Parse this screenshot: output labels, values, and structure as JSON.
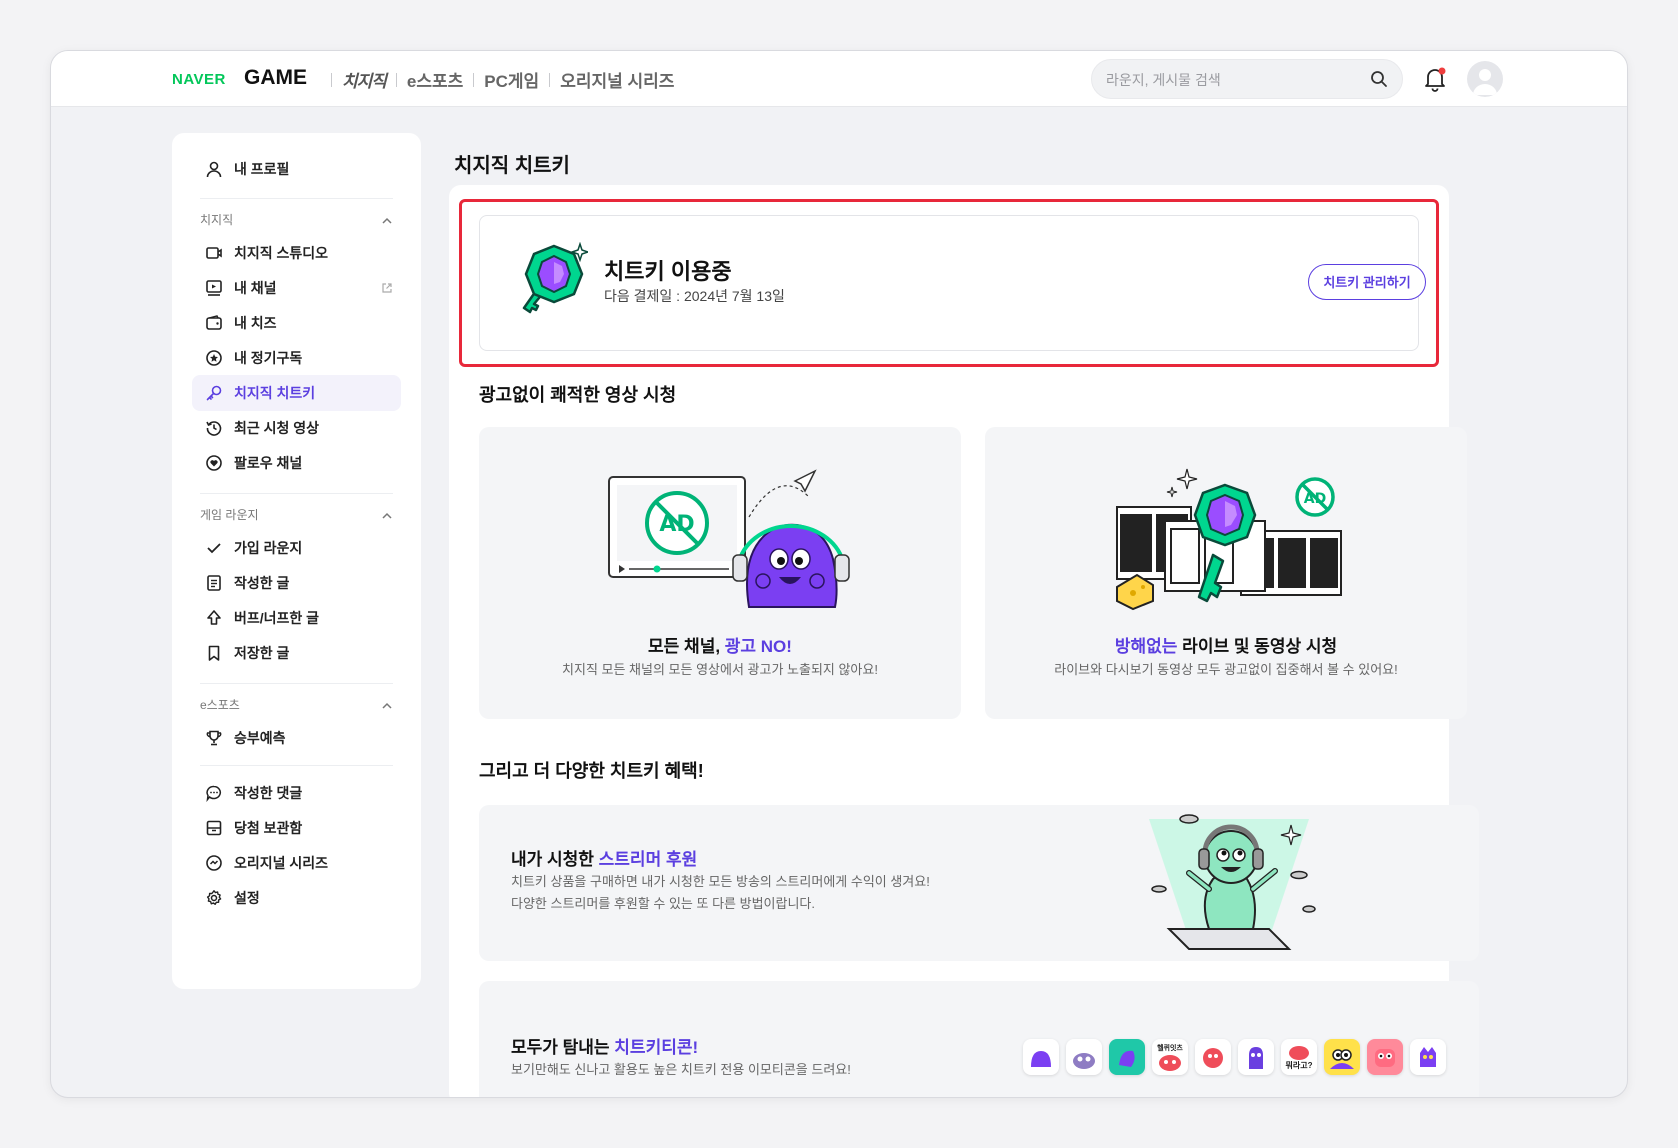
{
  "topbar": {
    "logo_naver": "NAVER",
    "logo_game": "GAME",
    "nav": [
      "치지직",
      "e스포츠",
      "PC게임",
      "오리지널 시리즈"
    ],
    "search_placeholder": "라운지, 게시물 검색",
    "search_value": ""
  },
  "sidebar": {
    "profile": "내 프로필",
    "sections": {
      "chzzk": "치지직",
      "lounge": "게임 라운지",
      "esports": "e스포츠"
    },
    "chzzk_items": [
      "치지직 스튜디오",
      "내 채널",
      "내 치즈",
      "내 정기구독",
      "치지직 치트키",
      "최근 시청 영상",
      "팔로우 채널"
    ],
    "lounge_items": [
      "가입 라운지",
      "작성한 글",
      "버프/너프한 글",
      "저장한 글"
    ],
    "esports_items": [
      "승부예측"
    ],
    "misc_items": [
      "작성한 댓글",
      "당첨 보관함",
      "오리지널 시리즈",
      "설정"
    ]
  },
  "page": {
    "title": "치지직 치트키",
    "status": {
      "title": "치트키 이용중",
      "next_payment": "다음 결제일 : 2024년 7월 13일",
      "manage_label": "치트키 관리하기"
    },
    "section1_title": "광고없이 쾌적한 영상 시청",
    "feature1": {
      "title_prefix": "모든 채널, ",
      "title_highlight": "광고 NO!",
      "desc": "치지직 모든 채널의 모든 영상에서 광고가 노출되지 않아요!",
      "ad_text": "AD"
    },
    "feature2": {
      "title_highlight": "방해없는",
      "title_suffix": " 라이브 및 동영상 시청",
      "desc": "라이브와 다시보기 동영상 모두 광고없이 집중해서 볼 수 있어요!",
      "ad_text": "AD"
    },
    "section2_title": "그리고 더 다양한 치트키 혜택!",
    "benefit1": {
      "title_prefix": "내가 시청한 ",
      "title_highlight": "스트리머 후원",
      "desc_line1": "치트키 상품을 구매하면 내가 시청한 모든 방송의 스트리머에게 수익이 생겨요!",
      "desc_line2": "다양한 스트리머를 후원할 수 있는 또 다른 방법이랍니다."
    },
    "benefit2": {
      "title_prefix": "모두가 탐내는 ",
      "title_highlight": "치트키티콘!",
      "desc": "보기만해도 신나고 활용도 높은 치트키 전용 이모티콘을 드려요!",
      "emoji_text_1": "헬퀴잇츠",
      "emoji_text_2": "뭐라고?"
    }
  },
  "colors": {
    "accent": "#5b3fe0",
    "naver_green": "#03c75a",
    "highlight_red": "#e8283a",
    "chzzk_green": "#00d68f"
  }
}
